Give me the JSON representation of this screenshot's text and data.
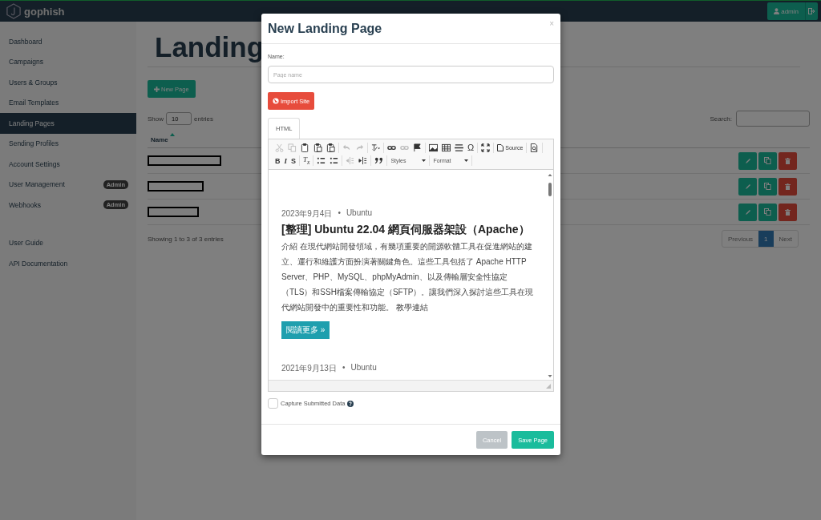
{
  "navbar": {
    "brand": "gophish",
    "user": "admin"
  },
  "sidebar": {
    "items": [
      {
        "label": "Dashboard",
        "selected": false
      },
      {
        "label": "Campaigns",
        "selected": false
      },
      {
        "label": "Users & Groups",
        "selected": false
      },
      {
        "label": "Email Templates",
        "selected": false
      },
      {
        "label": "Landing Pages",
        "selected": true
      },
      {
        "label": "Sending Profiles",
        "selected": false
      },
      {
        "label": "Account Settings",
        "selected": false
      },
      {
        "label": "User Management",
        "selected": false,
        "badge": "Admin"
      },
      {
        "label": "Webhooks",
        "selected": false,
        "badge": "Admin"
      }
    ],
    "help_items": [
      {
        "label": "User Guide",
        "selected": false
      },
      {
        "label": "API Documentation",
        "selected": false
      }
    ]
  },
  "page": {
    "title": "Landing",
    "new_button": "New Page",
    "show_label": "Show",
    "page_size": "10",
    "entries_label": "entries",
    "search_label": "Search:",
    "table": {
      "columns": [
        "Name"
      ],
      "rows": [
        {
          "kind": "redacted"
        },
        {
          "kind": "redacted"
        },
        {
          "kind": "redacted"
        }
      ]
    },
    "info": "Showing 1 to 3 of 3 entries",
    "pagination": [
      {
        "label": "Previous",
        "selected": false
      },
      {
        "label": "1",
        "selected": true
      },
      {
        "label": "Next",
        "selected": false
      }
    ]
  },
  "modal": {
    "title": "New Landing Page",
    "close": "×",
    "name_label": "Name:",
    "name_placeholder": "Page name",
    "import_button": "Import Site",
    "tabs": [
      {
        "label": "HTML",
        "selected": true
      }
    ],
    "toolbar": [
      [
        [
          {
            "kind": "cut",
            "disabled": true
          },
          {
            "kind": "copy",
            "disabled": true
          },
          {
            "kind": "paste",
            "disabled": false
          },
          {
            "kind": "pastetext",
            "disabled": false
          },
          {
            "kind": "pasteword",
            "disabled": false
          }
        ],
        [
          {
            "kind": "undo",
            "disabled": true
          },
          {
            "kind": "redo",
            "disabled": true
          }
        ],
        [
          {
            "kind": "spell",
            "disabled": false
          }
        ],
        [
          {
            "kind": "link",
            "disabled": false
          },
          {
            "kind": "unlink",
            "disabled": true
          },
          {
            "kind": "anchor",
            "disabled": false
          }
        ],
        [
          {
            "kind": "image",
            "disabled": false
          },
          {
            "kind": "table",
            "disabled": false
          },
          {
            "kind": "hline",
            "disabled": false
          },
          {
            "kind": "special",
            "label": "Ω",
            "disabled": false
          }
        ],
        [
          {
            "kind": "maximize",
            "disabled": false
          }
        ],
        [
          {
            "kind": "source",
            "label": "Source",
            "disabled": false
          }
        ],
        [
          {
            "kind": "preview",
            "disabled": false
          }
        ]
      ],
      [
        [
          {
            "kind": "bold",
            "label": "B",
            "disabled": false
          },
          {
            "kind": "italic",
            "label": "I",
            "disabled": false
          },
          {
            "kind": "strike",
            "label": "S",
            "disabled": false
          }
        ],
        [
          {
            "kind": "removeformat",
            "label": "T$_{x}$",
            "disabled": false
          }
        ],
        [
          {
            "kind": "numlist",
            "disabled": false
          },
          {
            "kind": "bullist",
            "disabled": false
          }
        ],
        [
          {
            "kind": "outdent",
            "disabled": true
          },
          {
            "kind": "indent",
            "disabled": false
          }
        ],
        [
          {
            "kind": "quote",
            "disabled": false
          }
        ],
        [
          {
            "kind": "dropdown",
            "label": "Styles",
            "disabled": false
          }
        ],
        [
          {
            "kind": "dropdown",
            "label": "Format",
            "disabled": false
          }
        ]
      ]
    ],
    "posts": [
      {
        "date": "2023年9月4日",
        "sep": "•",
        "category": "Ubuntu",
        "title": "[整理] Ubuntu 22.04 網頁伺服器架設（Apache）",
        "body": "介紹 在現代網站開發領域，有幾項重要的開源軟體工具在促進網站的建立、運行和維護方面扮演著關鍵角色。這些工具包括了 Apache HTTP Server、PHP、MySQL、phpMyAdmin、以及傳輸層安全性協定（TLS）和SSH檔案傳輸協定（SFTP）。讓我們深入探討這些工具在現代網站開發中的重要性和功能。 教學連結",
        "more": "閱讀更多 »"
      },
      {
        "date": "2021年9月13日",
        "sep": "•",
        "category": "Ubuntu"
      }
    ],
    "capture": {
      "label": "Capture Submitted Data",
      "checked": false
    },
    "buttons": [
      {
        "label": "Cancel",
        "kind": "cancel"
      },
      {
        "label": "Save Page",
        "kind": "save"
      }
    ]
  }
}
